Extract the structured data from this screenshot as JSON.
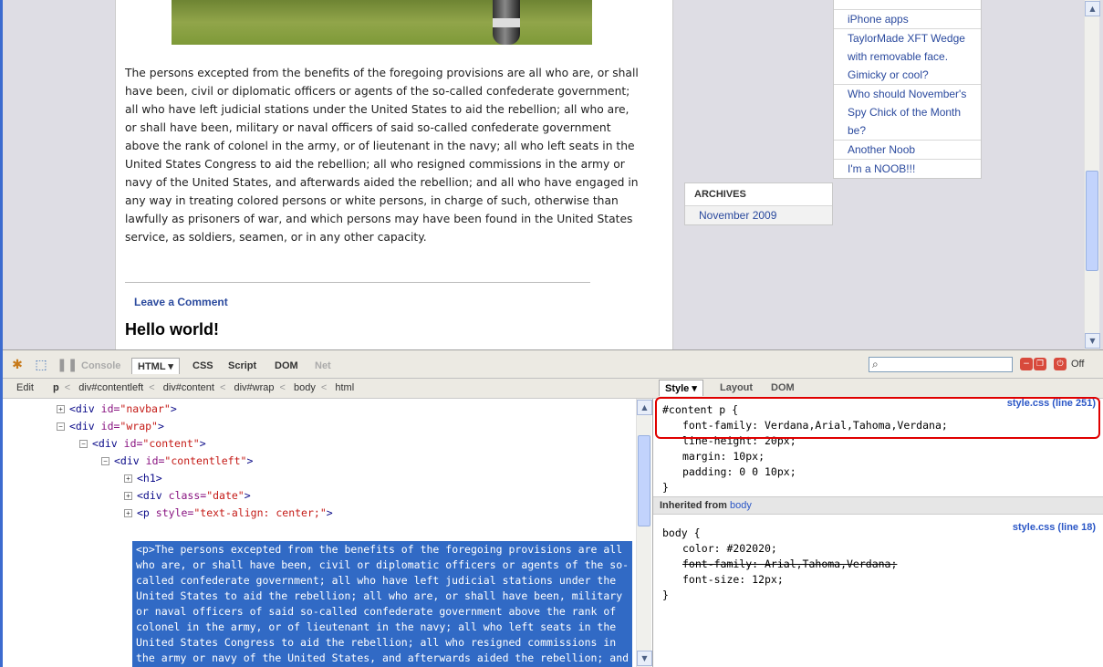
{
  "page": {
    "body_text": "The persons excepted from the benefits of the foregoing provisions are all who are, or shall have been, civil or diplomatic officers or agents of the so-called confederate government; all who have left judicial stations under the United States to aid the rebellion; all who are, or shall have been, military or naval officers of said so-called confederate government above the rank of colonel in the army, or of lieutenant in the navy; all who left seats in the United States Congress to aid the rebellion; all who resigned commissions in the army or navy of the United States, and afterwards aided the rebellion; and all who have engaged in any way in treating colored persons or white persons, in charge of such, otherwise than lawfully as prisoners of war, and which persons may have been found in the United States service, as soldiers, seamen, or in any other capacity.",
    "leave_comment": "Leave a Comment",
    "post_title": "Hello world!"
  },
  "sidebar": {
    "recent": [
      {
        "label": "iPhone apps"
      },
      {
        "label": "TaylorMade XFT Wedge with removable face. Gimicky or cool?"
      },
      {
        "label": "Who should November's Spy Chick of the Month be?"
      },
      {
        "label": "Another Noob"
      },
      {
        "label": "I'm a NOOB!!!"
      }
    ],
    "archives_title": "ARCHIVES",
    "archives_item": "November 2009"
  },
  "firebug": {
    "tabs": {
      "console": "Console",
      "html": "HTML ▾",
      "css": "CSS",
      "script": "Script",
      "dom": "DOM",
      "net": "Net"
    },
    "off_label": "Off",
    "search_placeholder": "",
    "breadcrumb": {
      "edit": "Edit",
      "items": [
        "p",
        "div#contentleft",
        "div#content",
        "div#wrap",
        "body",
        "html"
      ]
    },
    "tree": {
      "navbar_open": "<div",
      "navbar_attr_name": "id=",
      "navbar_attr_value": "\"navbar\"",
      "wrap_open": "<div",
      "wrap_attr_name": "id=",
      "wrap_attr_value": "\"wrap\"",
      "content_open": "<div",
      "content_attr_name": "id=",
      "content_attr_value": "\"content\"",
      "contentleft_open": "<div",
      "contentleft_attr_name": "id=",
      "contentleft_attr_value": "\"contentleft\"",
      "h1": "<h1>",
      "date_open": "<div",
      "date_attr_name": "class=",
      "date_attr_value": "\"date\"",
      "p_open": "<p",
      "p_attr_name": "style=",
      "p_attr_value": "\"text-align: center;\"",
      "close": ">",
      "selected_tag": "<p>",
      "selected_text": "The persons excepted from the benefits of the foregoing provisions are all who are, or shall have been, civil or diplomatic officers or agents of the so-called confederate government; all who have left judicial stations under the United States to aid the rebellion; all who are, or shall have been, military or naval officers of said so-called confederate government above the rank of colonel in the army, or of lieutenant in the navy; all who left seats in the United States Congress to aid the rebellion; all who resigned commissions in the army or navy of the United States, and afterwards aided the rebellion; and all who have engaged in any way in treating colored"
    },
    "style_tabs": {
      "style": "Style ▾",
      "layout": "Layout",
      "dom": "DOM"
    },
    "rule1": {
      "selector": "#content p {",
      "source": "style.css (line 251)",
      "props": [
        "font-family: Verdana,Arial,Tahoma,Verdana;",
        "line-height: 20px;",
        "margin: 10px;",
        "padding: 0 0 10px;"
      ],
      "close": "}"
    },
    "inherited_label": "Inherited from",
    "inherited_from": "body",
    "rule2": {
      "selector": "body {",
      "source": "style.css (line 18)",
      "props": [
        "color: #202020;",
        "font-family: Arial,Tahoma,Verdana;",
        "font-size: 12px;"
      ],
      "close": "}"
    }
  },
  "colors": {
    "selection": "#316ac5",
    "link": "#2b4a9e",
    "highlight": "#e00000"
  }
}
